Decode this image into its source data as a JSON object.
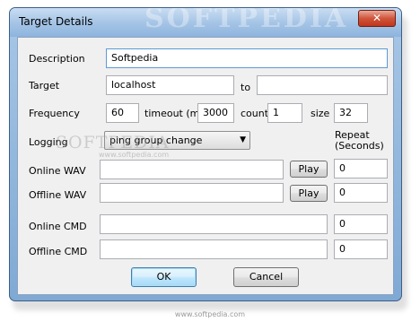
{
  "window": {
    "title": "Target Details",
    "close_glyph": "✕",
    "titlebar_watermark": "SOFTPEDIA"
  },
  "form": {
    "description": {
      "label": "Description",
      "value": "Softpedia"
    },
    "target": {
      "label": "Target",
      "value": "localhost",
      "to_label": "to",
      "to_value": ""
    },
    "frequency": {
      "label": "Frequency",
      "value": "60",
      "timeout_label": "timeout (ms)",
      "timeout_value": "3000",
      "count_label": "count",
      "count_value": "1",
      "size_label": "size",
      "size_value": "32"
    },
    "logging": {
      "label": "Logging",
      "selected": "ping group change",
      "arrow_icon": "▼"
    },
    "repeat_label_line1": "Repeat",
    "repeat_label_line2": "(Seconds)",
    "online_wav": {
      "label": "Online WAV",
      "value": "",
      "play_label": "Play",
      "repeat": "0"
    },
    "offline_wav": {
      "label": "Offline WAV",
      "value": "",
      "play_label": "Play",
      "repeat": "0"
    },
    "online_cmd": {
      "label": "Online CMD",
      "value": "",
      "repeat": "0"
    },
    "offline_cmd": {
      "label": "Offline CMD",
      "value": "",
      "repeat": "0"
    }
  },
  "buttons": {
    "ok": "OK",
    "cancel": "Cancel"
  },
  "watermark": {
    "main": "SOFTPEDIA",
    "sub": "www.softpedia.com",
    "bottom": "www.softpedia.com"
  }
}
